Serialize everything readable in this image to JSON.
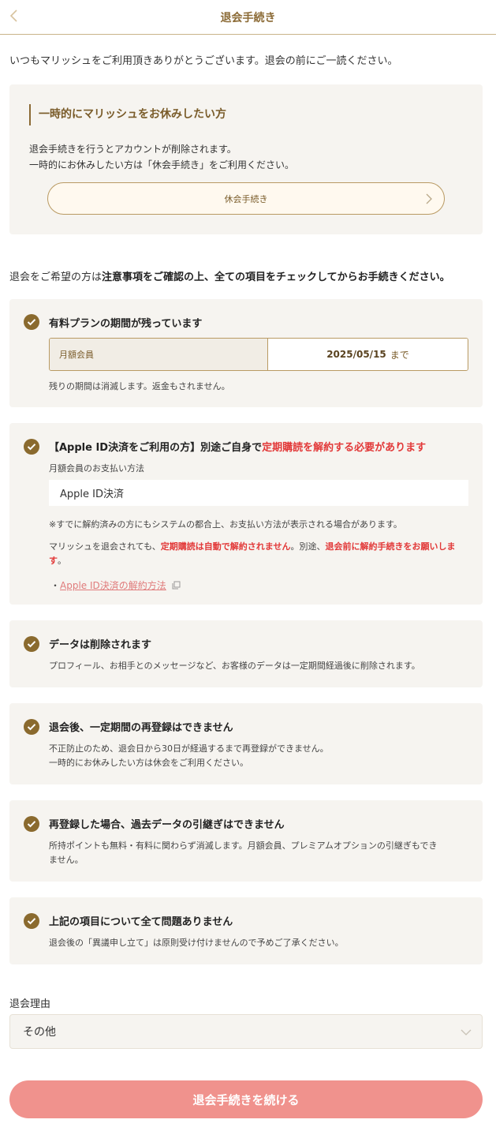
{
  "header": {
    "title": "退会手続き"
  },
  "intro": "いつもマリッシュをご利用頂きありがとうございます。退会の前にご一読ください。",
  "pause": {
    "heading": "一時的にマリッシュをお休みしたい方",
    "desc_line1": "退会手続きを行うとアカウントが削除されます。",
    "desc_line2": "一時的にお休みしたい方は「休会手続き」をご利用ください。",
    "button_label": "休会手続き"
  },
  "lead": {
    "part1": "退会をご希望の方は",
    "part2": "注意事項をご確認の上、全ての項目をチェックしてからお手続きください。"
  },
  "checks": {
    "plan": {
      "title": "有料プランの期間が残っています",
      "plan_name": "月額会員",
      "plan_date": "2025/05/15",
      "plan_until": "まで",
      "note": "残りの期間は消滅します。返金もされません。"
    },
    "apple": {
      "title_prefix": "【Apple ID決済をご利用の方】別途ご自身で",
      "title_red": "定期購読を解約する必要があります",
      "payment_label": "月額会員のお支払い方法",
      "payment_value": "Apple ID決済",
      "note1": "※すでに解約済みの方にもシステムの都合上、お支払い方法が表示される場合があります。",
      "note2_a": "マリッシュを退会されても、",
      "note2_b": "定期購読は自動で解約されません",
      "note2_c": "。別途、",
      "note2_d": "退会前に解約手続きをお願いします",
      "note2_e": "。",
      "link_bullet": "・",
      "link_label": "Apple ID決済の解約方法"
    },
    "data": {
      "title": "データは削除されます",
      "text": "プロフィール、お相手とのメッセージなど、お客様のデータは一定期間経過後に削除されます。"
    },
    "rereg": {
      "title": "退会後、一定期間の再登録はできません",
      "line1": "不正防止のため、退会日から30日が経過するまで再登録ができません。",
      "line2": "一時的にお休みしたい方は休会をご利用ください。"
    },
    "transfer": {
      "title": "再登録した場合、過去データの引継ぎはできません",
      "line1": "所持ポイントも無料・有料に関わらず消滅します。月額会員、プレミアムオプションの引継ぎもでき",
      "line2": "ません。"
    },
    "agree": {
      "title": "上記の項目について全て問題ありません",
      "text": "退会後の「異議申し立て」は原則受け付けませんので予めご了承ください。"
    }
  },
  "reason": {
    "label": "退会理由",
    "selected": "その他"
  },
  "submit_label": "退会手続きを続ける",
  "colors": {
    "accent": "#8a6a2e",
    "alert": "#e23838",
    "submit": "#f0928d",
    "panel": "#f6f4f0"
  },
  "icons": [
    "chevron-left-icon",
    "chevron-right-icon",
    "check-circle-icon",
    "external-link-icon",
    "chevron-down-icon"
  ]
}
